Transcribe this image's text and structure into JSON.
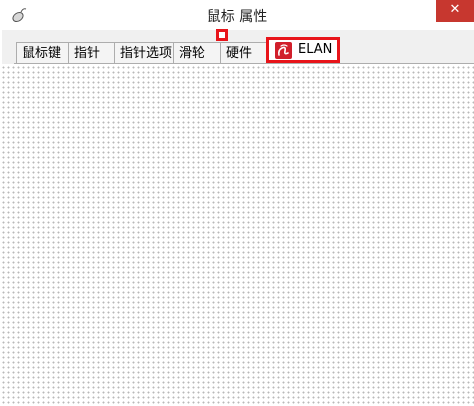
{
  "window": {
    "title": "鼠标 属性",
    "close_symbol": "✕",
    "app_icon": "mouse-icon"
  },
  "tabs": [
    {
      "label": "鼠标键"
    },
    {
      "label": "指针"
    },
    {
      "label": "指针选项"
    },
    {
      "label": "滑轮"
    },
    {
      "label": "硬件"
    },
    {
      "label": "ELAN",
      "icon": "elan-logo-icon",
      "highlighted": true
    }
  ],
  "colors": {
    "highlight": "#e8141a",
    "close_button": "#c7372f",
    "elan_logo": "#d11f2b"
  }
}
